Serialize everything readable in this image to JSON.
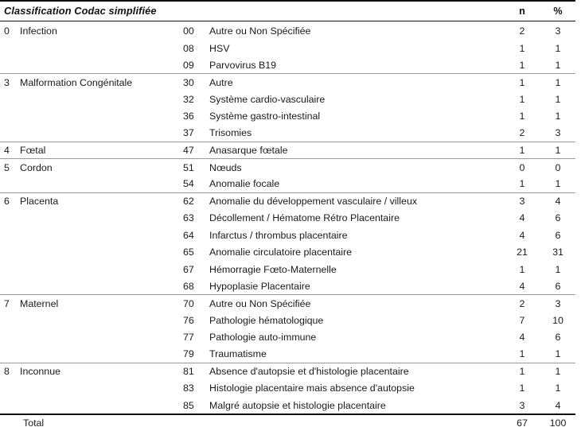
{
  "table": {
    "header": {
      "title": "Classification Codac simplifiée",
      "n_label": "n",
      "pct_label": "%"
    },
    "groups": [
      {
        "code": "0",
        "label": "Infection",
        "rows": [
          {
            "code": "00",
            "label": "Autre ou Non Spécifiée",
            "n": "2",
            "pct": "3"
          },
          {
            "code": "08",
            "label": "HSV",
            "n": "1",
            "pct": "1"
          },
          {
            "code": "09",
            "label": "Parvovirus B19",
            "n": "1",
            "pct": "1"
          }
        ]
      },
      {
        "code": "3",
        "label": "Malformation Congénitale",
        "rows": [
          {
            "code": "30",
            "label": "Autre",
            "n": "1",
            "pct": "1"
          },
          {
            "code": "32",
            "label": "Système cardio-vasculaire",
            "n": "1",
            "pct": "1"
          },
          {
            "code": "36",
            "label": "Système gastro-intestinal",
            "n": "1",
            "pct": "1"
          },
          {
            "code": "37",
            "label": "Trisomies",
            "n": "2",
            "pct": "3"
          }
        ]
      },
      {
        "code": "4",
        "label": "Fœtal",
        "rows": [
          {
            "code": "47",
            "label": "Anasarque fœtale",
            "n": "1",
            "pct": "1"
          }
        ]
      },
      {
        "code": "5",
        "label": "Cordon",
        "rows": [
          {
            "code": "51",
            "label": "Nœuds",
            "n": "0",
            "pct": "0"
          },
          {
            "code": "54",
            "label": "Anomalie focale",
            "n": "1",
            "pct": "1"
          }
        ]
      },
      {
        "code": "6",
        "label": "Placenta",
        "rows": [
          {
            "code": "62",
            "label": "Anomalie du développement vasculaire / villeux",
            "n": "3",
            "pct": "4"
          },
          {
            "code": "63",
            "label": "Décollement / Hématome Rétro Placentaire",
            "n": "4",
            "pct": "6"
          },
          {
            "code": "64",
            "label": "Infarctus / thrombus placentaire",
            "n": "4",
            "pct": "6"
          },
          {
            "code": "65",
            "label": "Anomalie circulatoire placentaire",
            "n": "21",
            "pct": "31"
          },
          {
            "code": "67",
            "label": "Hémorragie Fœto-Maternelle",
            "n": "1",
            "pct": "1"
          },
          {
            "code": "68",
            "label": "Hypoplasie Placentaire",
            "n": "4",
            "pct": "6"
          }
        ]
      },
      {
        "code": "7",
        "label": "Maternel",
        "rows": [
          {
            "code": "70",
            "label": "Autre ou Non Spécifiée",
            "n": "2",
            "pct": "3"
          },
          {
            "code": "76",
            "label": "Pathologie hématologique",
            "n": "7",
            "pct": "10"
          },
          {
            "code": "77",
            "label": "Pathologie auto-immune",
            "n": "4",
            "pct": "6"
          },
          {
            "code": "79",
            "label": "Traumatisme",
            "n": "1",
            "pct": "1"
          }
        ]
      },
      {
        "code": "8",
        "label": "Inconnue",
        "rows": [
          {
            "code": "81",
            "label": "Absence d'autopsie et d'histologie placentaire",
            "n": "1",
            "pct": "1"
          },
          {
            "code": "83",
            "label": "Histologie placentaire mais absence d'autopsie",
            "n": "1",
            "pct": "1"
          },
          {
            "code": "85",
            "label": "Malgré autopsie et histologie placentaire",
            "n": "3",
            "pct": "4"
          }
        ]
      }
    ],
    "total": {
      "label": "Total",
      "n": "67",
      "pct": "100"
    }
  }
}
